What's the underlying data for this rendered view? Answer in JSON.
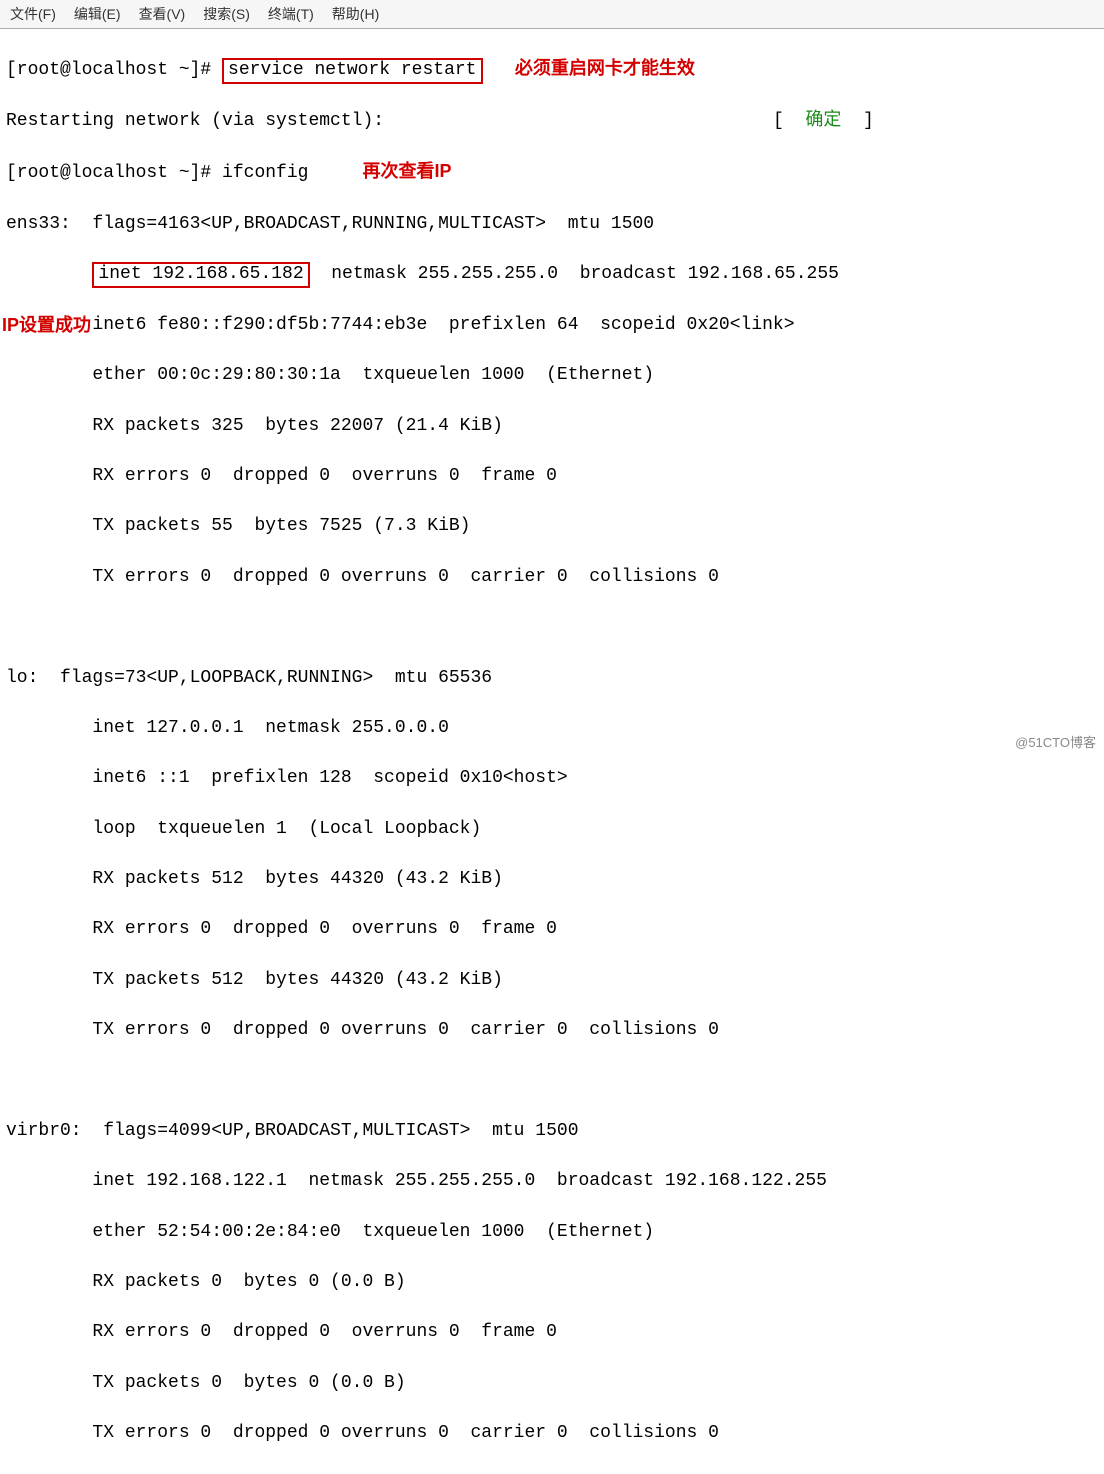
{
  "menubar": [
    "文件(F)",
    "编辑(E)",
    "查看(V)",
    "搜索(S)",
    "终端(T)",
    "帮助(H)"
  ],
  "prompt": "[root@localhost ~]# ",
  "cmd1": "service network restart",
  "note1": "必须重启网卡才能生效",
  "restart_line_pre": "Restarting network (via systemctl):",
  "restart_status_l": "[  ",
  "restart_status_ok": "确定",
  "restart_status_r": "  ]",
  "cmd2": "ifconfig",
  "note2": "再次查看IP",
  "ip_success": "IP设置成功",
  "ens33": {
    "head": "ens33:  flags=4163<UP,BROADCAST,RUNNING,MULTICAST>  mtu 1500",
    "inet_box": "inet 192.168.65.182",
    "inet_rest": "  netmask 255.255.255.0  broadcast 192.168.65.255",
    "inet6": "        inet6 fe80::f290:df5b:7744:eb3e  prefixlen 64  scopeid 0x20<link>",
    "ether": "        ether 00:0c:29:80:30:1a  txqueuelen 1000  (Ethernet)",
    "rxp": "        RX packets 325  bytes 22007 (21.4 KiB)",
    "rxe": "        RX errors 0  dropped 0  overruns 0  frame 0",
    "txp": "        TX packets 55  bytes 7525 (7.3 KiB)",
    "txe": "        TX errors 0  dropped 0 overruns 0  carrier 0  collisions 0"
  },
  "lo": {
    "head": "lo:  flags=73<UP,LOOPBACK,RUNNING>  mtu 65536",
    "inet": "        inet 127.0.0.1  netmask 255.0.0.0",
    "inet6": "        inet6 ::1  prefixlen 128  scopeid 0x10<host>",
    "loop": "        loop  txqueuelen 1  (Local Loopback)",
    "rxp": "        RX packets 512  bytes 44320 (43.2 KiB)",
    "rxe": "        RX errors 0  dropped 0  overruns 0  frame 0",
    "txp": "        TX packets 512  bytes 44320 (43.2 KiB)",
    "txe": "        TX errors 0  dropped 0 overruns 0  carrier 0  collisions 0"
  },
  "virbr0": {
    "head": "virbr0:  flags=4099<UP,BROADCAST,MULTICAST>  mtu 1500",
    "inet": "        inet 192.168.122.1  netmask 255.255.255.0  broadcast 192.168.122.255",
    "ether": "        ether 52:54:00:2e:84:e0  txqueuelen 1000  (Ethernet)",
    "rxp": "        RX packets 0  bytes 0 (0.0 B)",
    "rxe": "        RX errors 0  dropped 0  overruns 0  frame 0",
    "txp": "        TX packets 0  bytes 0 (0.0 B)",
    "txe": "        TX errors 0  dropped 0 overruns 0  carrier 0  collisions 0"
  },
  "watermark": "@51CTO博客"
}
